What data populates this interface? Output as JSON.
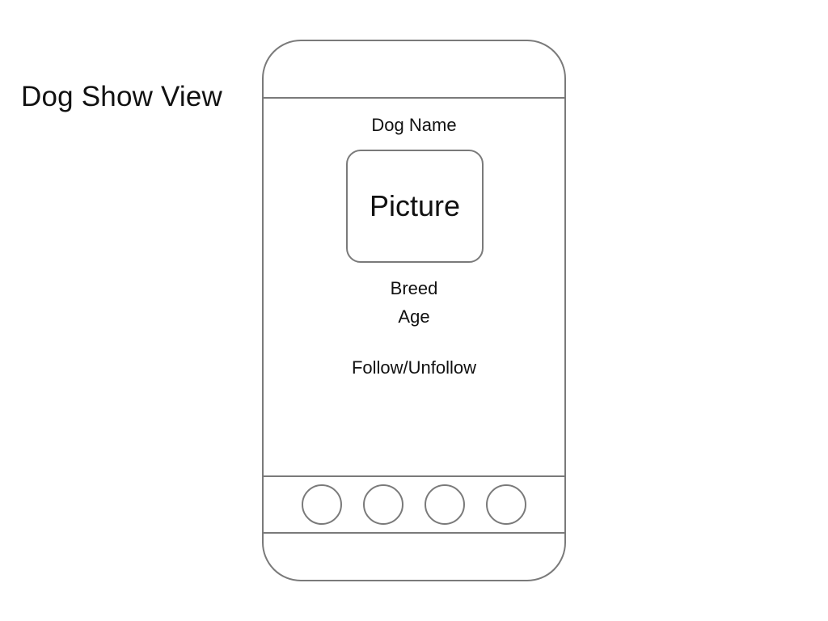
{
  "page": {
    "title": "Dog Show View"
  },
  "phone": {
    "content": {
      "dog_name": "Dog Name",
      "picture_label": "Picture",
      "breed": "Breed",
      "age": "Age",
      "follow_toggle": "Follow/Unfollow"
    },
    "tab_bar": {
      "tabs": [
        {
          "icon": "circle-tab-icon"
        },
        {
          "icon": "circle-tab-icon"
        },
        {
          "icon": "circle-tab-icon"
        },
        {
          "icon": "circle-tab-icon"
        }
      ]
    }
  },
  "colors": {
    "outline": "#7a7a7a",
    "text": "#111111",
    "background": "#ffffff"
  }
}
